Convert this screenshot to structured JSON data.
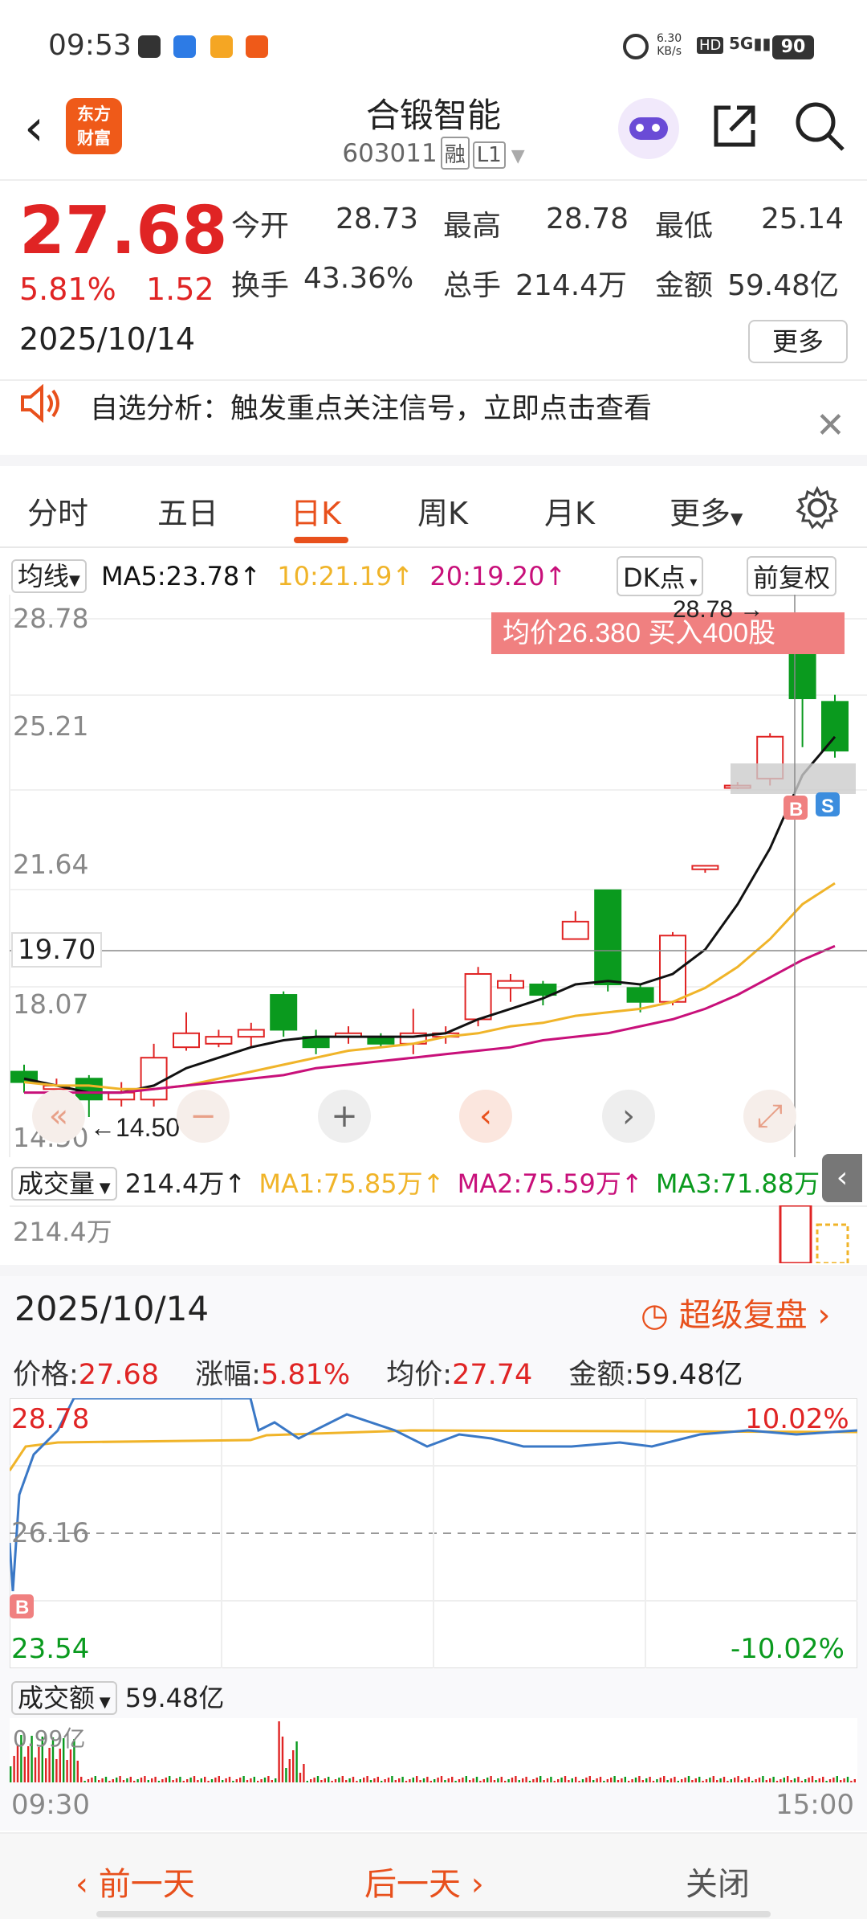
{
  "status": {
    "time": "09:53",
    "net_speed": "6.30\nKB/s",
    "battery": "90"
  },
  "header": {
    "back": "‹",
    "logo": "东方\n财富",
    "title": "合锻智能",
    "code": "603011",
    "tag1": "融",
    "tag2": "L1"
  },
  "quote": {
    "price": "27.68",
    "pct": "5.81%",
    "chg": "1.52",
    "date": "2025/10/14",
    "open_label": "今开",
    "open": "28.73",
    "high_label": "最高",
    "high": "28.78",
    "low_label": "最低",
    "low": "25.14",
    "turnover_label": "换手",
    "turnover": "43.36%",
    "vol_label": "总手",
    "vol": "214.4万",
    "amt_label": "金额",
    "amt": "59.48亿",
    "more": "更多"
  },
  "notice": {
    "text": "自选分析：触发重点关注信号，立即点击查看"
  },
  "tabs": [
    "分时",
    "五日",
    "日K",
    "周K",
    "月K",
    "更多"
  ],
  "kline": {
    "ma_selector": "均线",
    "ma5": "MA5:23.78↑",
    "ma10": "10:21.19↑",
    "ma20": "20:19.20↑",
    "dk": "DK点",
    "fq": "前复权",
    "y_labels": [
      "28.78",
      "25.21",
      "21.64",
      "18.07",
      "14.50"
    ],
    "crosshair_price": "19.70",
    "max_label": "28.78",
    "min_label": "14.50",
    "trade_badge": "均价26.380  买入400股",
    "b_mark": "B",
    "s_mark": "S",
    "colors": {
      "up": "#e02424",
      "down": "#0a9a1e",
      "ma5": "#111111",
      "ma10": "#f0b429",
      "ma20": "#c8107a"
    }
  },
  "volume": {
    "selector": "成交量",
    "vol": "214.4万↑",
    "ma1": "MA1:75.85万↑",
    "ma2": "MA2:75.59万↑",
    "ma3": "MA3:71.88万↑",
    "ylabel": "214.4万"
  },
  "replay": {
    "date": "2025/10/14",
    "link": "超级复盘",
    "price_label": "价格:",
    "price": "27.68",
    "pct_label": "涨幅:",
    "pct": "5.81%",
    "avg_label": "均价:",
    "avg": "27.74",
    "amt_label": "金额:",
    "amt": "59.48亿",
    "y_top": "28.78",
    "y_mid": "26.16",
    "y_bot": "23.54",
    "pct_top": "10.02%",
    "pct_bot": "-10.02%",
    "b_mark": "B",
    "amt_selector": "成交额",
    "amt_total": "59.48亿",
    "amt_ylabel": "0.99亿",
    "t_start": "09:30",
    "t_end": "15:00"
  },
  "bottom": {
    "prev": "前一天",
    "next": "后一天",
    "close": "关闭"
  }
}
